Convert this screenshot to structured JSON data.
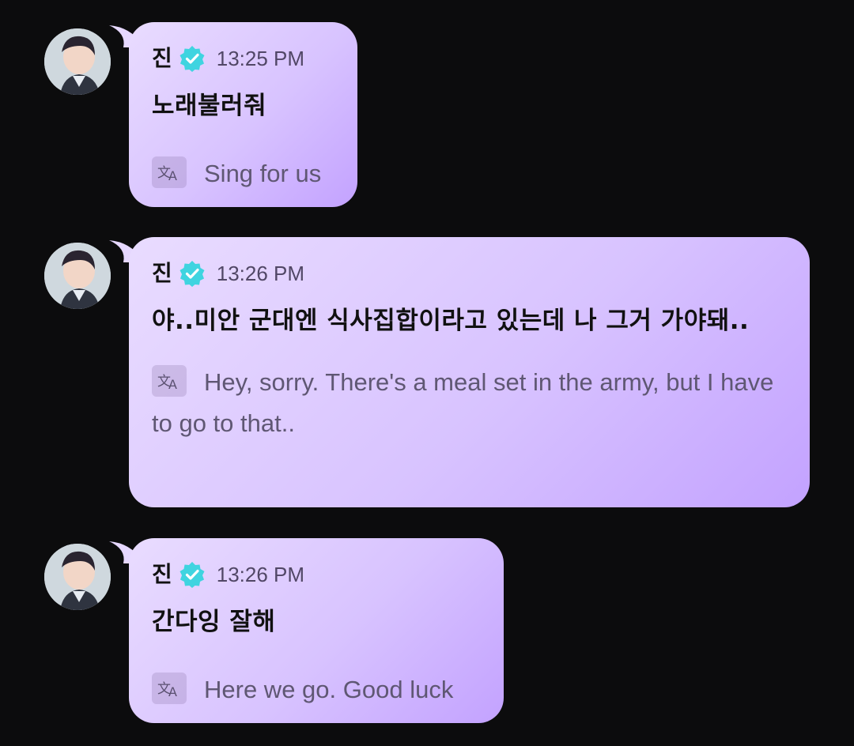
{
  "messages": [
    {
      "author": "진",
      "time": "13:25 PM",
      "text": "노래불러줘",
      "translation": "Sing for us"
    },
    {
      "author": "진",
      "time": "13:26 PM",
      "text": "야..미안 군대엔 식사집합이라고 있는데 나 그거 가야돼..",
      "translation": "Hey, sorry. There's a meal set in the army, but I have to go to that.."
    },
    {
      "author": "진",
      "time": "13:26 PM",
      "text": "간다잉 잘해",
      "translation": "Here we go. Good luck"
    }
  ],
  "icons": {
    "verified": "verified-badge-icon",
    "translate": "translate-icon"
  },
  "colors": {
    "background": "#0c0c0d",
    "bubble_start": "#e9dcff",
    "bubble_end": "#c3a2ff",
    "verified": "#3fd4e0"
  }
}
